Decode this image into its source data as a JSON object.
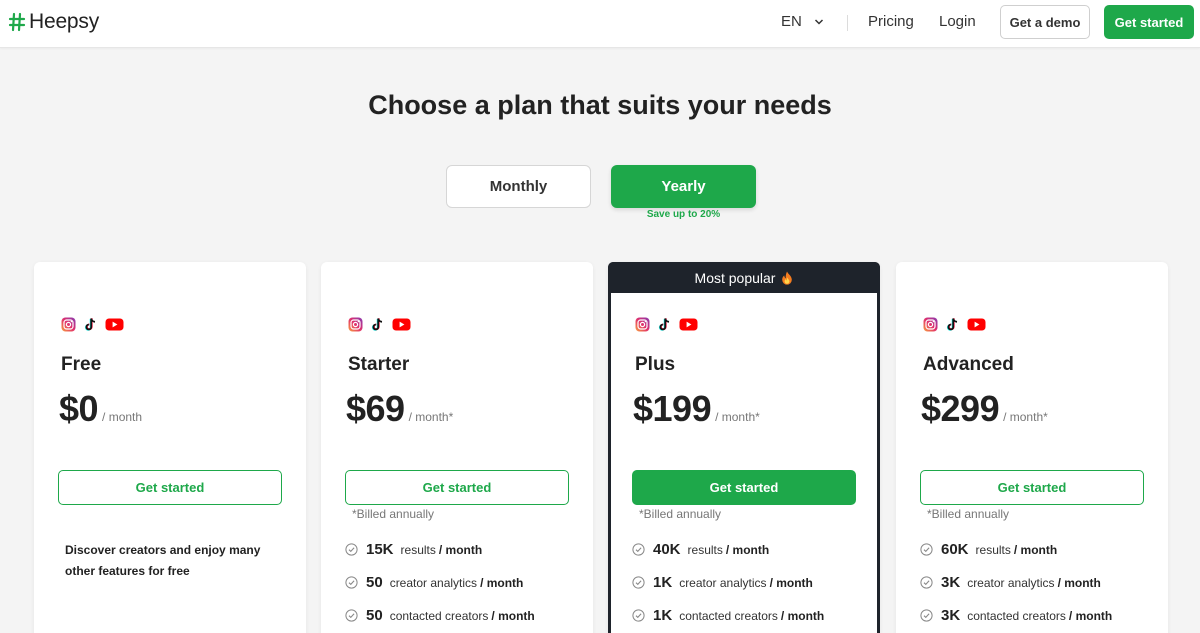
{
  "brand": {
    "name": "Heepsy",
    "accent": "#1ea84a",
    "dark": "#1e232b"
  },
  "nav": {
    "language": "EN",
    "pricing": "Pricing",
    "login": "Login",
    "demo_button": "Get a demo",
    "start_button": "Get started"
  },
  "page": {
    "title": "Choose a plan that suits your needs"
  },
  "billing_toggle": {
    "monthly": "Monthly",
    "yearly": "Yearly",
    "selected": "Yearly",
    "save_note": "Save up to 20%"
  },
  "plans": [
    {
      "name": "Free",
      "price": "$0",
      "period": "/ month",
      "button": "Get started",
      "description": "Discover creators and enjoy many other features for free"
    },
    {
      "name": "Starter",
      "price": "$69",
      "period": "/ month*",
      "button": "Get started",
      "billed": "*Billed annually",
      "features": [
        {
          "value": "15K",
          "label": "results",
          "unit": "/ month"
        },
        {
          "value": "50",
          "label": "creator analytics",
          "unit": "/ month"
        },
        {
          "value": "50",
          "label": "contacted creators",
          "unit": "/ month"
        }
      ]
    },
    {
      "name": "Plus",
      "badge": "Most popular",
      "price": "$199",
      "period": "/ month*",
      "button": "Get started",
      "billed": "*Billed annually",
      "features": [
        {
          "value": "40K",
          "label": "results",
          "unit": "/ month"
        },
        {
          "value": "1K",
          "label": "creator analytics",
          "unit": "/ month"
        },
        {
          "value": "1K",
          "label": "contacted creators",
          "unit": "/ month"
        }
      ]
    },
    {
      "name": "Advanced",
      "price": "$299",
      "period": "/ month*",
      "button": "Get started",
      "billed": "*Billed annually",
      "features": [
        {
          "value": "60K",
          "label": "results",
          "unit": "/ month"
        },
        {
          "value": "3K",
          "label": "creator analytics",
          "unit": "/ month"
        },
        {
          "value": "3K",
          "label": "contacted creators",
          "unit": "/ month"
        }
      ]
    }
  ],
  "icons": {
    "platforms": [
      "instagram-icon",
      "tiktok-icon",
      "youtube-icon"
    ],
    "feature_check": "check-circle-icon",
    "badge_emoji": "fire-icon"
  }
}
